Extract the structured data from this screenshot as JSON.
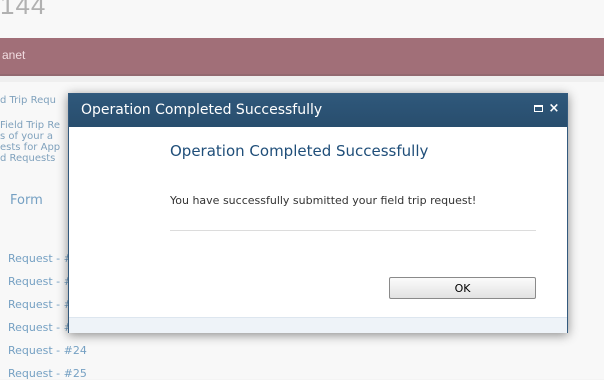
{
  "background": {
    "title_fragment": "144",
    "topbar_label": "anet",
    "lines": [
      "d Trip Requ",
      "Field Trip Re",
      "s of your a",
      "ests for App",
      "d Requests"
    ],
    "form_label": "Form",
    "list_items": [
      "Request - #",
      "Request - #",
      "Request - #",
      "Request - #",
      "Request - #24",
      "Request - #25"
    ]
  },
  "dialog": {
    "title": "Operation Completed Successfully",
    "heading": "Operation Completed Successfully",
    "message": "You have successfully submitted your field trip request!",
    "ok_label": "OK",
    "maximize_icon": "maximize-icon",
    "close_icon": "close-icon",
    "close_glyph": "×"
  },
  "colors": {
    "header": "#2f587b",
    "heading_text": "#1f4e79",
    "topbar": "#6f2230",
    "link": "#2b6ea3"
  }
}
